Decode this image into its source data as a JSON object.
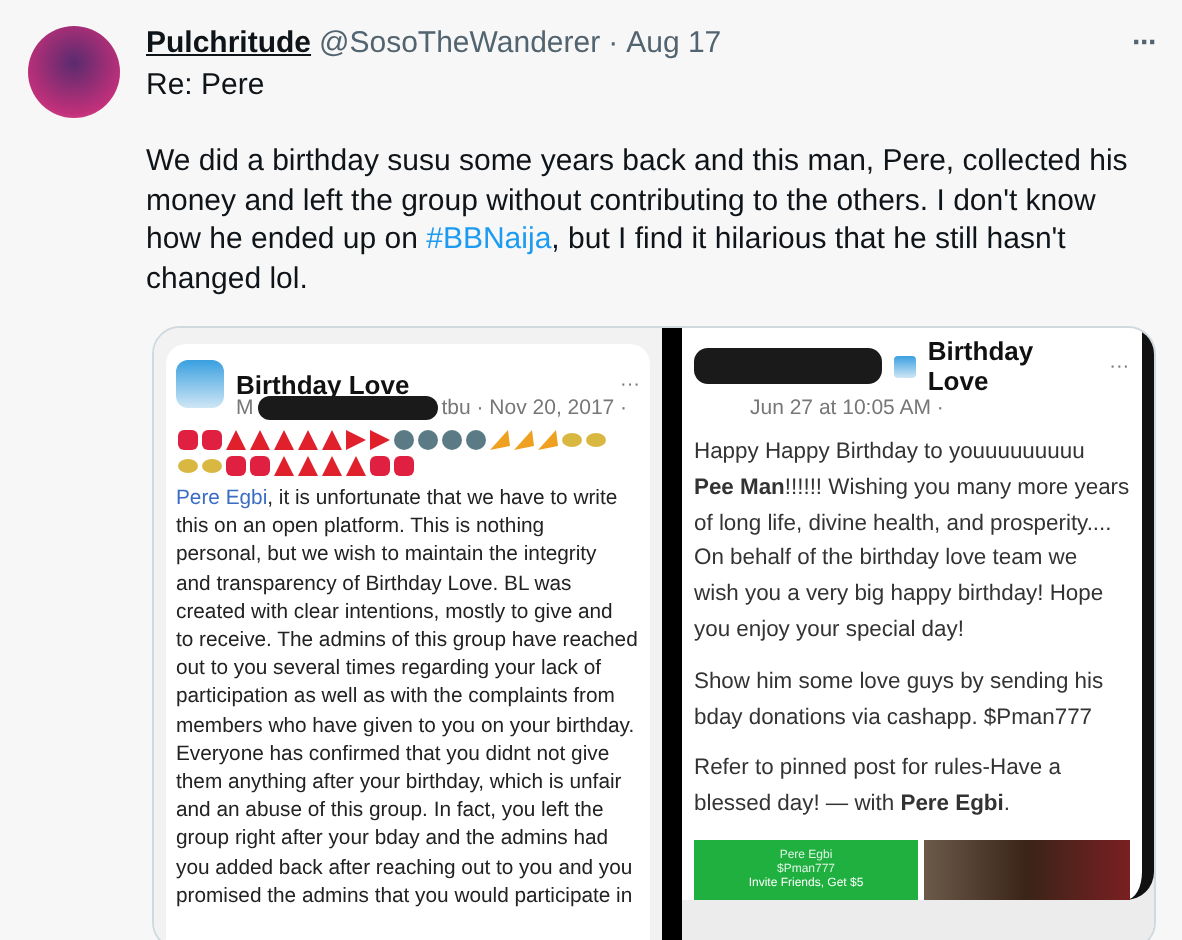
{
  "tweet": {
    "name": "Pulchritude",
    "handle": "@SosoTheWanderer",
    "separator": "·",
    "date": "Aug 17",
    "more": "···",
    "subject": "Re: Pere",
    "body": {
      "before": "We did a birthday susu some years back and this man, Pere, collected his money and left the group without contributing to the others. I don't know how he ended up on ",
      "hashtag": "#BBNaija",
      "after": ", but I find it hilarious that he still hasn't changed lol."
    }
  },
  "left_post": {
    "page": "Birthday Love",
    "author_start": "M",
    "meta": "tbu · Nov 20, 2017 ·",
    "more": "···",
    "link": "Pere Egbi",
    "lines": [
      ", it is unfortunate that we have to write",
      "this on an open platform.  This is nothing",
      "personal, but we wish to maintain the integrity",
      "and transparency of Birthday Love.  BL was",
      "created with clear intentions, mostly to give and",
      "to receive. The admins of this group have reached",
      "out to you several times regarding your lack of",
      "participation as well as with the complaints from",
      "members who have given to you on your birthday.",
      "Everyone has confirmed that you didnt not give",
      "them anything after your birthday, which is unfair",
      "and an abuse of this group. In fact, you left the",
      "group right after your bday and the admins had",
      "you added back after reaching out to you and you",
      "promised the admins that you would participate in"
    ]
  },
  "right_post": {
    "page": "Birthday Love",
    "meta": "Jun 27 at 10:05 AM ·",
    "more": "···",
    "paragraphs": [
      [
        "Happy Happy Birthday to youuuuuuuuu",
        "**Pee Man**!!!!!! Wishing you many more years",
        "of long life, divine health, and prosperity....",
        "On behalf of the birthday love team we",
        "wish you a very big happy birthday! Hope",
        "you enjoy your special day!"
      ],
      [
        "Show him some love guys by sending his",
        "bday donations via cashapp. $Pman777"
      ],
      [
        "Refer to pinned post for rules-Have a",
        "blessed day! — with **Pere Egbi**."
      ]
    ],
    "cashapp": {
      "name": "Pere Egbi",
      "tag": "$Pman777",
      "invite": "Invite Friends, Get $5"
    }
  }
}
